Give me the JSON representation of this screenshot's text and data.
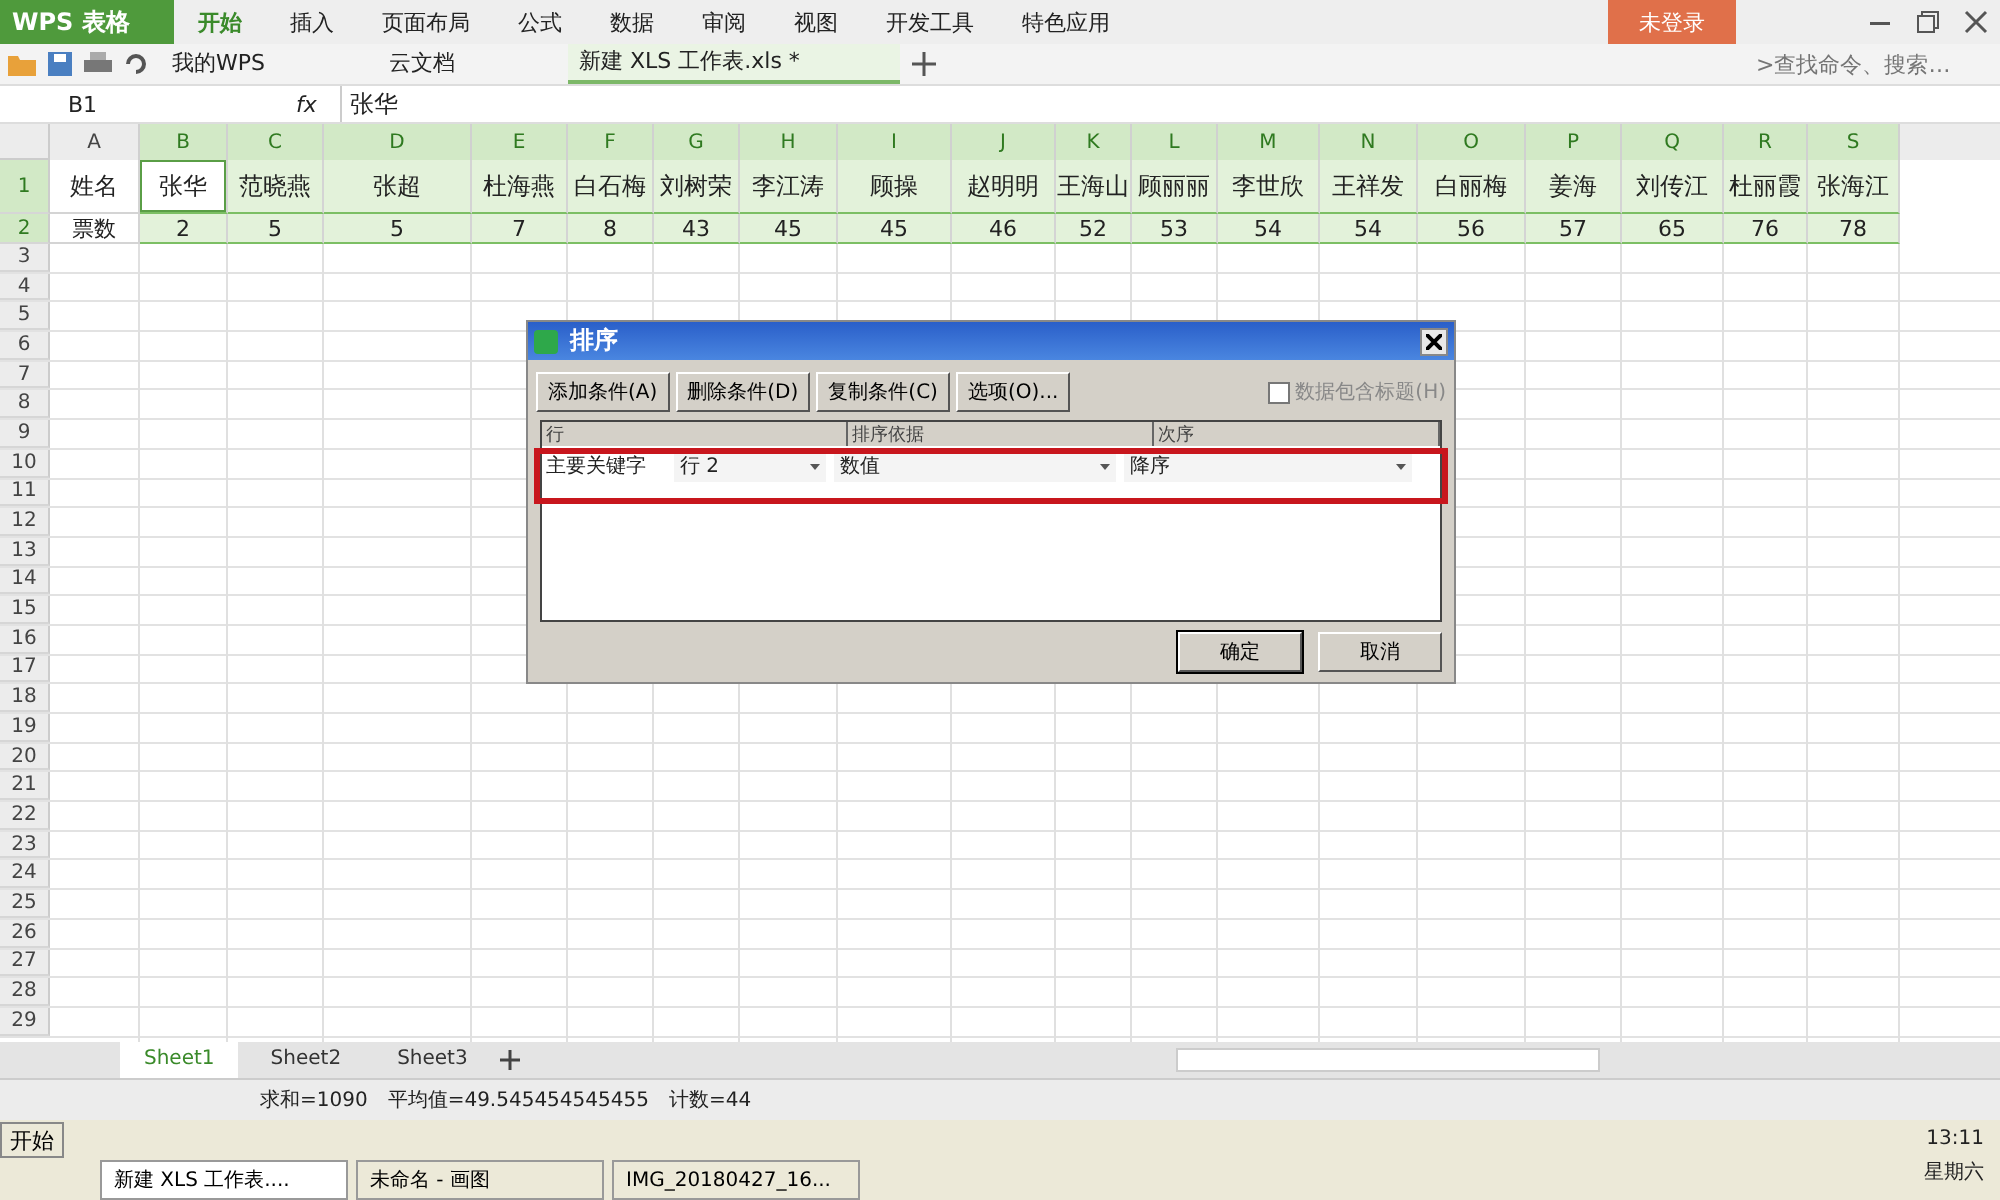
{
  "app": {
    "logo": "WPS 表格",
    "login": "未登录"
  },
  "ribbon_tabs": [
    {
      "label": "开始",
      "selected": true
    },
    {
      "label": "插入",
      "selected": false
    },
    {
      "label": "页面布局",
      "selected": false
    },
    {
      "label": "公式",
      "selected": false
    },
    {
      "label": "数据",
      "selected": false
    },
    {
      "label": "审阅",
      "selected": false
    },
    {
      "label": "视图",
      "selected": false
    },
    {
      "label": "开发工具",
      "selected": false
    },
    {
      "label": "特色应用",
      "selected": false
    }
  ],
  "doc_tabs": [
    {
      "label": "我的WPS",
      "selected": false
    },
    {
      "label": "云文档",
      "selected": false
    },
    {
      "label": "新建 XLS 工作表.xls *",
      "selected": true
    }
  ],
  "search": {
    "placeholder": ">查找命令、搜索…"
  },
  "formula_bar": {
    "cell_ref": "B1",
    "fx": "fx",
    "value": "张华"
  },
  "sheet": {
    "columns": [
      {
        "label": "A",
        "selected": false
      },
      {
        "label": "B",
        "selected": true
      },
      {
        "label": "C",
        "selected": true
      },
      {
        "label": "D",
        "selected": true
      },
      {
        "label": "E",
        "selected": true
      },
      {
        "label": "F",
        "selected": true
      },
      {
        "label": "G",
        "selected": true
      },
      {
        "label": "H",
        "selected": true
      },
      {
        "label": "I",
        "selected": true
      },
      {
        "label": "J",
        "selected": true
      },
      {
        "label": "K",
        "selected": true
      },
      {
        "label": "L",
        "selected": true
      },
      {
        "label": "M",
        "selected": true
      },
      {
        "label": "N",
        "selected": true
      },
      {
        "label": "O",
        "selected": true
      },
      {
        "label": "P",
        "selected": true
      },
      {
        "label": "Q",
        "selected": true
      },
      {
        "label": "R",
        "selected": true
      },
      {
        "label": "S",
        "selected": true
      }
    ],
    "rows": [
      {
        "header": "1",
        "selected": true,
        "cells": [
          {
            "text": "姓名",
            "active": false
          },
          {
            "text": "张华",
            "active": true
          },
          {
            "text": "范晓燕",
            "active": false
          },
          {
            "text": "张超",
            "active": false
          },
          {
            "text": "杜海燕",
            "active": false
          },
          {
            "text": "白石梅",
            "active": false
          },
          {
            "text": "刘树荣",
            "active": false
          },
          {
            "text": "李江涛",
            "active": false
          },
          {
            "text": "顾操",
            "active": false
          },
          {
            "text": "赵明明",
            "active": false
          },
          {
            "text": "王海山",
            "active": false
          },
          {
            "text": "顾丽丽",
            "active": false
          },
          {
            "text": "李世欣",
            "active": false
          },
          {
            "text": "王祥发",
            "active": false
          },
          {
            "text": "白丽梅",
            "active": false
          },
          {
            "text": "姜海",
            "active": false
          },
          {
            "text": "刘传江",
            "active": false
          },
          {
            "text": "杜丽霞",
            "active": false
          },
          {
            "text": "张海江",
            "active": false
          }
        ]
      },
      {
        "header": "2",
        "selected": true,
        "cells": [
          {
            "text": "票数",
            "active": false
          },
          {
            "text": "2",
            "active": false
          },
          {
            "text": "5",
            "active": false
          },
          {
            "text": "5",
            "active": false
          },
          {
            "text": "7",
            "active": false
          },
          {
            "text": "8",
            "active": false
          },
          {
            "text": "43",
            "active": false
          },
          {
            "text": "45",
            "active": false
          },
          {
            "text": "45",
            "active": false
          },
          {
            "text": "46",
            "active": false
          },
          {
            "text": "52",
            "active": false
          },
          {
            "text": "53",
            "active": false
          },
          {
            "text": "54",
            "active": false
          },
          {
            "text": "54",
            "active": false
          },
          {
            "text": "56",
            "active": false
          },
          {
            "text": "57",
            "active": false
          },
          {
            "text": "65",
            "active": false
          },
          {
            "text": "76",
            "active": false
          },
          {
            "text": "78",
            "active": false
          }
        ]
      }
    ],
    "empty_rows": [
      "3",
      "4",
      "5",
      "6",
      "7",
      "8",
      "9",
      "10",
      "11",
      "12",
      "13",
      "14",
      "15",
      "16",
      "17",
      "18",
      "19",
      "20",
      "21",
      "22",
      "23",
      "24",
      "25",
      "26",
      "27",
      "28",
      "29"
    ]
  },
  "dialog": {
    "title": "排序",
    "toolbar": [
      "添加条件(A)",
      "删除条件(D)",
      "复制条件(C)",
      "选项(O)..."
    ],
    "header_checkbox": {
      "label": "数据包含标题(H)",
      "checked": false,
      "disabled": true
    },
    "columns": [
      "行",
      "排序依据",
      "次序"
    ],
    "conditions": [
      {
        "label": "主要关键字",
        "key": "行 2",
        "basis": "数值",
        "order": "降序",
        "highlighted": true
      }
    ],
    "buttons": [
      "确定",
      "取消"
    ]
  },
  "sheet_tabs": [
    {
      "label": "Sheet1",
      "selected": true
    },
    {
      "label": "Sheet2",
      "selected": false
    },
    {
      "label": "Sheet3",
      "selected": false
    }
  ],
  "status_bar": [
    "求和=1090",
    "平均值=49.545454545455",
    "计数=44"
  ],
  "taskbar": {
    "start": "开始",
    "windows": [
      {
        "label": "新建 XLS 工作表....",
        "selected": true
      },
      {
        "label": "未命名 - 画图",
        "selected": false
      },
      {
        "label": "IMG_20180427_16...",
        "selected": false
      }
    ],
    "time": "13:11",
    "day": "星期六"
  }
}
